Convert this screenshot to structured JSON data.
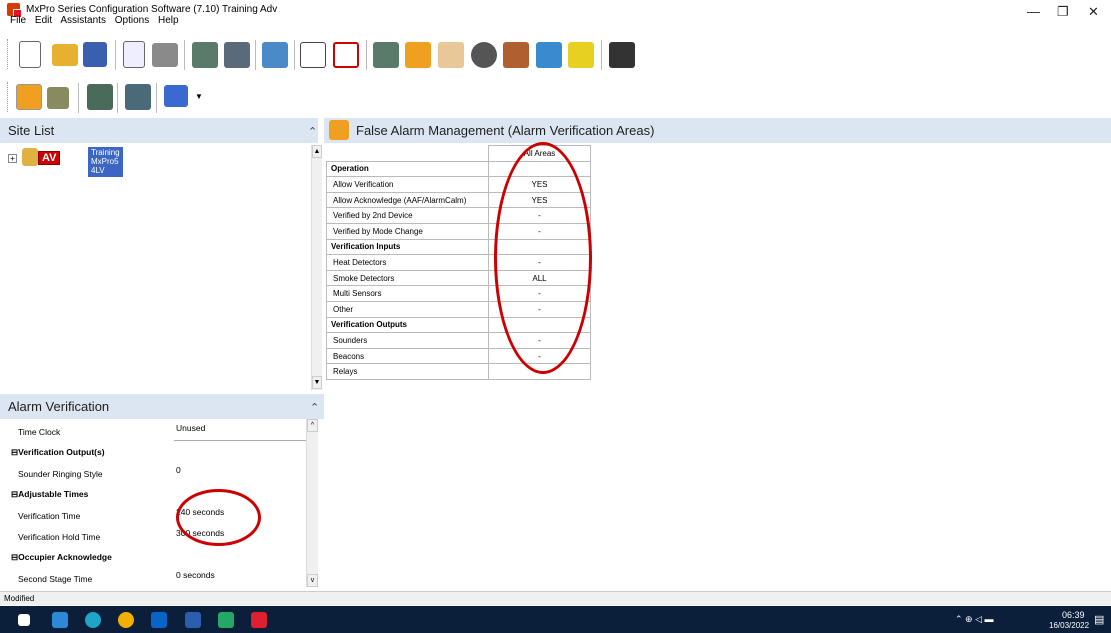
{
  "window": {
    "title": "MxPro Series Configuration Software (7.10)   Training Adv",
    "minimize": "—",
    "restore": "❐",
    "close": "✕"
  },
  "menu": [
    "File",
    "Edit",
    "Assistants",
    "Options",
    "Help"
  ],
  "site_list": {
    "header": "Site List",
    "tree_expander": "+",
    "node_badge": "AV",
    "node_line1": "Training",
    "node_line2": "MxPro5 4LV"
  },
  "main": {
    "header": "False Alarm Management (Alarm Verification Areas)",
    "column_header": "All Areas",
    "rows": [
      {
        "label": "Operation",
        "value": "",
        "section": true
      },
      {
        "label": "Allow Verification",
        "value": "YES",
        "section": false
      },
      {
        "label": "Allow Acknowledge (AAF/AlarmCalm)",
        "value": "YES",
        "section": false
      },
      {
        "label": "Verified by 2nd Device",
        "value": "-",
        "section": false
      },
      {
        "label": "Verified by Mode Change",
        "value": "-",
        "section": false
      },
      {
        "label": "Verification Inputs",
        "value": "",
        "section": true
      },
      {
        "label": "Heat Detectors",
        "value": "-",
        "section": false
      },
      {
        "label": "Smoke Detectors",
        "value": "ALL",
        "section": false
      },
      {
        "label": "Multi Sensors",
        "value": "-",
        "section": false
      },
      {
        "label": "Other",
        "value": "-",
        "section": false
      },
      {
        "label": "Verification Outputs",
        "value": "",
        "section": true
      },
      {
        "label": "Sounders",
        "value": "-",
        "section": false
      },
      {
        "label": "Beacons",
        "value": "-",
        "section": false
      },
      {
        "label": "Relays",
        "value": "",
        "section": false
      }
    ]
  },
  "alarm_verification": {
    "header": "Alarm Verification",
    "props": [
      {
        "name": "Time Clock",
        "value": "Unused",
        "section": false
      },
      {
        "name": "⊟Verification Output(s)",
        "value": "",
        "section": true
      },
      {
        "name": "Sounder Ringing Style",
        "value": "0",
        "section": false
      },
      {
        "name": "⊟Adjustable Times",
        "value": "",
        "section": true
      },
      {
        "name": "Verification Time",
        "value": "240 seconds",
        "section": false
      },
      {
        "name": "Verification Hold Time",
        "value": "300 seconds",
        "section": false
      },
      {
        "name": "⊟Occupier Acknowledge",
        "value": "",
        "section": true
      },
      {
        "name": "Second Stage Time",
        "value": "0 seconds",
        "section": false
      }
    ]
  },
  "status": "Modified",
  "taskbar": {
    "time": "06:39",
    "date": "16/03/2022"
  },
  "colors": {
    "panel_header": "#dce6f2",
    "selection": "#3b66c4",
    "annotation": "#cc0000",
    "taskbar": "#0b1e3a"
  }
}
